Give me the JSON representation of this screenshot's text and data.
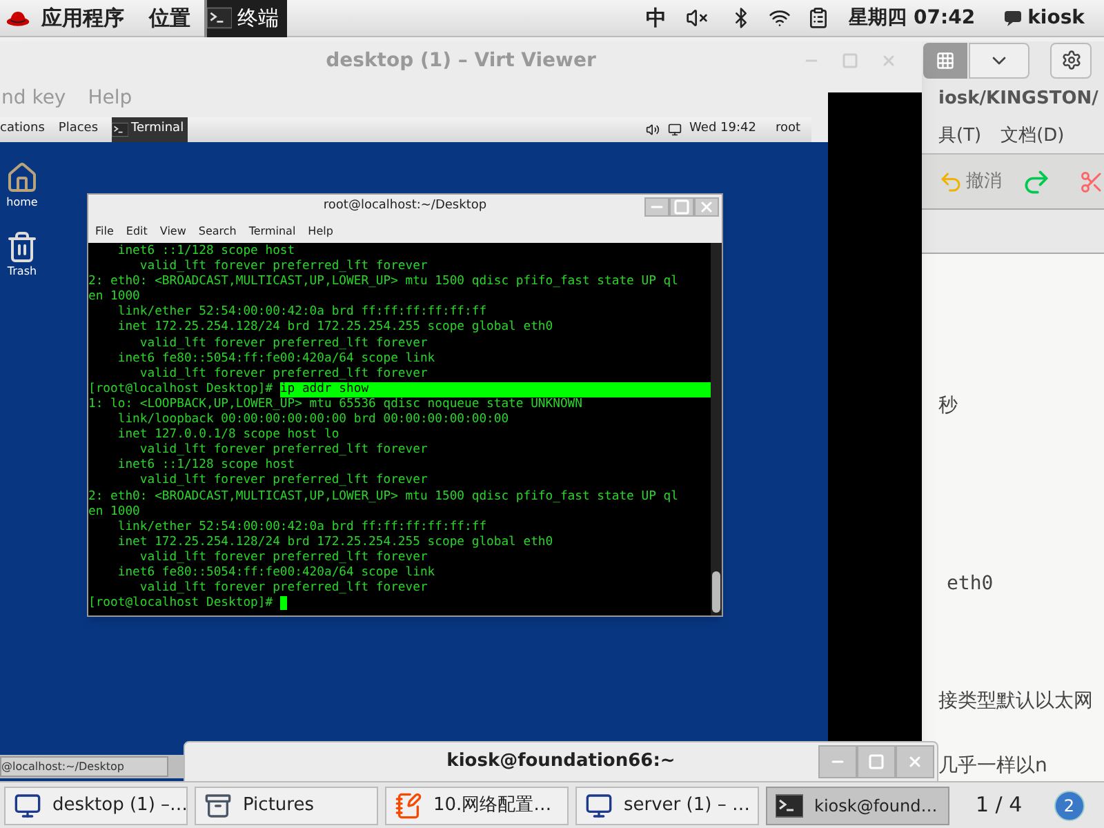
{
  "top_bar": {
    "menus": [
      "应用程序",
      "位置"
    ],
    "task": "终端",
    "input_method": "中",
    "clock": "星期四 07:42",
    "user": "kiosk"
  },
  "editor_window": {
    "path": "iosk/KINGSTON/",
    "menus": [
      "具(T)",
      "文档(D)"
    ],
    "undo_label": "撤消",
    "lines": [
      {
        "kind": "text",
        "text": "秒"
      },
      {
        "kind": "code",
        "text": "eth0"
      },
      {
        "kind": "text",
        "text": "接类型默认以太网"
      },
      {
        "kind": "text",
        "text": "几乎一样以n"
      }
    ]
  },
  "viewer": {
    "title": "desktop (1) – Virt Viewer",
    "menus": [
      "nd key",
      "Help"
    ]
  },
  "guest": {
    "panel": {
      "menus": [
        "cations",
        "Places"
      ],
      "task": "Terminal",
      "clock": "Wed 19:42",
      "user": "root"
    },
    "desktop_icons": [
      {
        "kind": "folder",
        "label": "home"
      },
      {
        "kind": "trash",
        "label": "Trash"
      }
    ],
    "terminal": {
      "title": "root@localhost:~/Desktop",
      "menus": [
        "File",
        "Edit",
        "View",
        "Search",
        "Terminal",
        "Help"
      ],
      "lines": [
        {
          "kind": "output",
          "text": "    inet6 ::1/128 scope host"
        },
        {
          "kind": "output",
          "text": "       valid_lft forever preferred_lft forever"
        },
        {
          "kind": "output",
          "text": "2: eth0: <BROADCAST,MULTICAST,UP,LOWER_UP> mtu 1500 qdisc pfifo_fast state UP ql"
        },
        {
          "kind": "output",
          "text": "en 1000"
        },
        {
          "kind": "output",
          "text": "    link/ether 52:54:00:00:42:0a brd ff:ff:ff:ff:ff:ff"
        },
        {
          "kind": "output",
          "text": "    inet 172.25.254.128/24 brd 172.25.254.255 scope global eth0"
        },
        {
          "kind": "output",
          "text": "       valid_lft forever preferred_lft forever"
        },
        {
          "kind": "output",
          "text": "    inet6 fe80::5054:ff:fe00:420a/64 scope link"
        },
        {
          "kind": "output",
          "text": "       valid_lft forever preferred_lft forever"
        },
        {
          "kind": "prompt",
          "prompt": "[root@localhost Desktop]#",
          "command": "ip addr show",
          "highlighted": true,
          "cursor": false
        },
        {
          "kind": "output",
          "text": "1: lo: <LOOPBACK,UP,LOWER_UP> mtu 65536 qdisc noqueue state UNKNOWN"
        },
        {
          "kind": "output",
          "text": "    link/loopback 00:00:00:00:00:00 brd 00:00:00:00:00:00"
        },
        {
          "kind": "output",
          "text": "    inet 127.0.0.1/8 scope host lo"
        },
        {
          "kind": "output",
          "text": "       valid_lft forever preferred_lft forever"
        },
        {
          "kind": "output",
          "text": "    inet6 ::1/128 scope host"
        },
        {
          "kind": "output",
          "text": "       valid_lft forever preferred_lft forever"
        },
        {
          "kind": "output",
          "text": "2: eth0: <BROADCAST,MULTICAST,UP,LOWER_UP> mtu 1500 qdisc pfifo_fast state UP ql"
        },
        {
          "kind": "output",
          "text": "en 1000"
        },
        {
          "kind": "output",
          "text": "    link/ether 52:54:00:00:42:0a brd ff:ff:ff:ff:ff:ff"
        },
        {
          "kind": "output",
          "text": "    inet 172.25.254.128/24 brd 172.25.254.255 scope global eth0"
        },
        {
          "kind": "output",
          "text": "       valid_lft forever preferred_lft forever"
        },
        {
          "kind": "output",
          "text": "    inet6 fe80::5054:ff:fe00:420a/64 scope link"
        },
        {
          "kind": "output",
          "text": "       valid_lft forever preferred_lft forever"
        },
        {
          "kind": "prompt",
          "prompt": "[root@localhost Desktop]#",
          "highlighted": false,
          "cursor": true
        }
      ]
    },
    "bottom_task": "@localhost:~/Desktop"
  },
  "kiosk_window": {
    "title": "kiosk@foundation66:~"
  },
  "taskbar": {
    "items": [
      {
        "kind": "monitor",
        "label": "desktop (1) –…",
        "selected": false
      },
      {
        "kind": "cabinet",
        "label": "Pictures",
        "selected": false
      },
      {
        "kind": "notepad",
        "label": "10.网络配置…",
        "selected": false
      },
      {
        "kind": "monitor",
        "label": "server (1) – …",
        "selected": false
      },
      {
        "kind": "terminal",
        "label": "kiosk@found…",
        "selected": true
      }
    ],
    "workspace": "1 / 4",
    "badge": "2"
  }
}
